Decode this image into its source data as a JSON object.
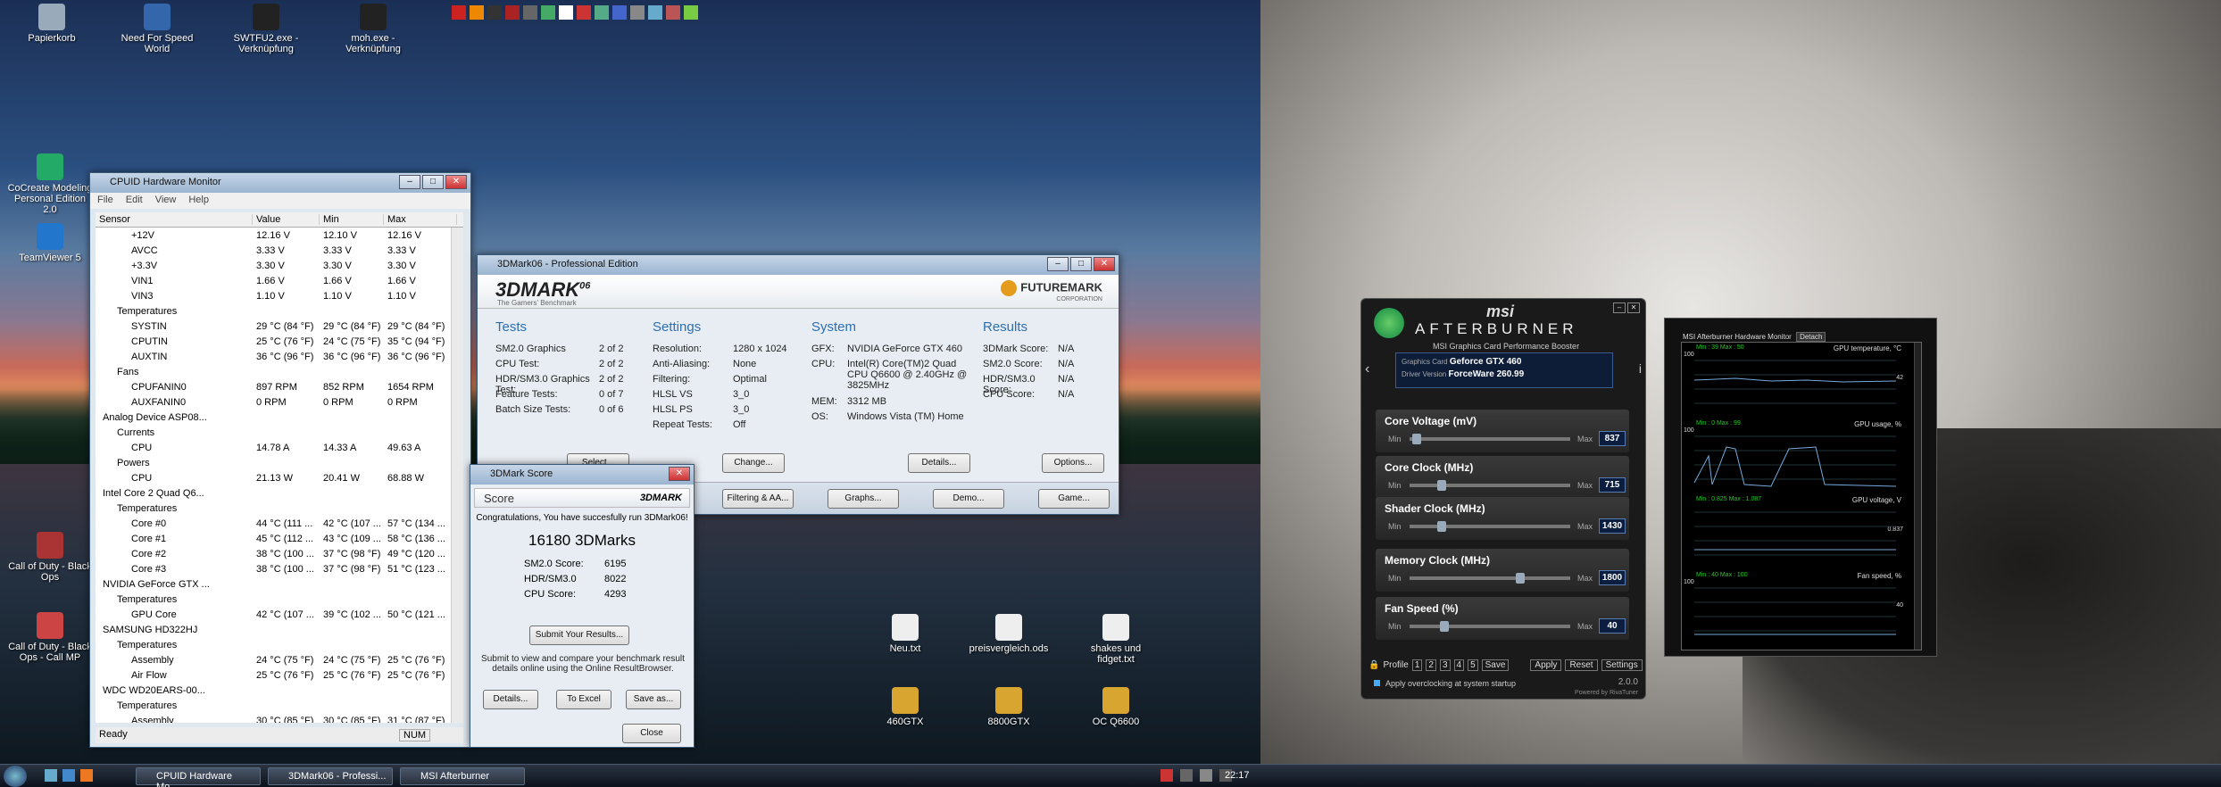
{
  "desktop_left": {
    "icons": [
      {
        "label": "Papierkorb"
      },
      {
        "label": "Need For Speed World"
      },
      {
        "label": "SWTFU2.exe - Verknüpfung"
      },
      {
        "label": "moh.exe - Verknüpfung"
      },
      {
        "label": "CoCreate Modeling Personal Edition 2.0"
      },
      {
        "label": "TeamViewer 5"
      },
      {
        "label": "Call of Duty - Black Ops"
      },
      {
        "label": "Call of Duty - Black Ops - Call MP"
      },
      {
        "label": "Neu.txt"
      },
      {
        "label": "preisvergleich.ods"
      },
      {
        "label": "shakes und fidget.txt"
      },
      {
        "label": "460GTX"
      },
      {
        "label": "8800GTX"
      },
      {
        "label": "OC Q6600"
      }
    ]
  },
  "cpuid": {
    "title": "CPUID Hardware Monitor",
    "menu": [
      "File",
      "Edit",
      "View",
      "Help"
    ],
    "columns": [
      "Sensor",
      "Value",
      "Min",
      "Max"
    ],
    "rows": [
      {
        "sensor": "+12V",
        "value": "12.16 V",
        "min": "12.10 V",
        "max": "12.16 V",
        "indent": 5
      },
      {
        "sensor": "AVCC",
        "value": "3.33 V",
        "min": "3.33 V",
        "max": "3.33 V",
        "indent": 5
      },
      {
        "sensor": "+3.3V",
        "value": "3.30 V",
        "min": "3.30 V",
        "max": "3.30 V",
        "indent": 5
      },
      {
        "sensor": "VIN1",
        "value": "1.66 V",
        "min": "1.66 V",
        "max": "1.66 V",
        "indent": 5
      },
      {
        "sensor": "VIN3",
        "value": "1.10 V",
        "min": "1.10 V",
        "max": "1.10 V",
        "indent": 5
      },
      {
        "sensor": "Temperatures",
        "value": "",
        "min": "",
        "max": "",
        "indent": 3
      },
      {
        "sensor": "SYSTIN",
        "value": "29 °C (84 °F)",
        "min": "29 °C (84 °F)",
        "max": "29 °C (84 °F)",
        "indent": 5
      },
      {
        "sensor": "CPUTIN",
        "value": "25 °C (76 °F)",
        "min": "24 °C (75 °F)",
        "max": "35 °C (94 °F)",
        "indent": 5
      },
      {
        "sensor": "AUXTIN",
        "value": "36 °C (96 °F)",
        "min": "36 °C (96 °F)",
        "max": "36 °C (96 °F)",
        "indent": 5
      },
      {
        "sensor": "Fans",
        "value": "",
        "min": "",
        "max": "",
        "indent": 3
      },
      {
        "sensor": "CPUFANIN0",
        "value": "897 RPM",
        "min": "852 RPM",
        "max": "1654 RPM",
        "indent": 5
      },
      {
        "sensor": "AUXFANIN0",
        "value": "0 RPM",
        "min": "0 RPM",
        "max": "0 RPM",
        "indent": 5
      },
      {
        "sensor": "Analog Device ASP08...",
        "value": "",
        "min": "",
        "max": "",
        "indent": 1
      },
      {
        "sensor": "Currents",
        "value": "",
        "min": "",
        "max": "",
        "indent": 3
      },
      {
        "sensor": "CPU",
        "value": "14.78 A",
        "min": "14.33 A",
        "max": "49.63 A",
        "indent": 5
      },
      {
        "sensor": "Powers",
        "value": "",
        "min": "",
        "max": "",
        "indent": 3
      },
      {
        "sensor": "CPU",
        "value": "21.13 W",
        "min": "20.41 W",
        "max": "68.88 W",
        "indent": 5
      },
      {
        "sensor": "Intel Core 2 Quad Q6...",
        "value": "",
        "min": "",
        "max": "",
        "indent": 1
      },
      {
        "sensor": "Temperatures",
        "value": "",
        "min": "",
        "max": "",
        "indent": 3
      },
      {
        "sensor": "Core #0",
        "value": "44 °C (111 ...",
        "min": "42 °C (107 ...",
        "max": "57 °C (134 ...",
        "indent": 5
      },
      {
        "sensor": "Core #1",
        "value": "45 °C (112 ...",
        "min": "43 °C (109 ...",
        "max": "58 °C (136 ...",
        "indent": 5
      },
      {
        "sensor": "Core #2",
        "value": "38 °C (100 ...",
        "min": "37 °C (98 °F)",
        "max": "49 °C (120 ...",
        "indent": 5
      },
      {
        "sensor": "Core #3",
        "value": "38 °C (100 ...",
        "min": "37 °C (98 °F)",
        "max": "51 °C (123 ...",
        "indent": 5
      },
      {
        "sensor": "NVIDIA GeForce GTX ...",
        "value": "",
        "min": "",
        "max": "",
        "indent": 1
      },
      {
        "sensor": "Temperatures",
        "value": "",
        "min": "",
        "max": "",
        "indent": 3
      },
      {
        "sensor": "GPU Core",
        "value": "42 °C (107 ...",
        "min": "39 °C (102 ...",
        "max": "50 °C (121 ...",
        "indent": 5
      },
      {
        "sensor": "SAMSUNG HD322HJ",
        "value": "",
        "min": "",
        "max": "",
        "indent": 1
      },
      {
        "sensor": "Temperatures",
        "value": "",
        "min": "",
        "max": "",
        "indent": 3
      },
      {
        "sensor": "Assembly",
        "value": "24 °C (75 °F)",
        "min": "24 °C (75 °F)",
        "max": "25 °C (76 °F)",
        "indent": 5
      },
      {
        "sensor": "Air Flow",
        "value": "25 °C (76 °F)",
        "min": "25 °C (76 °F)",
        "max": "25 °C (76 °F)",
        "indent": 5
      },
      {
        "sensor": "WDC WD20EARS-00...",
        "value": "",
        "min": "",
        "max": "",
        "indent": 1
      },
      {
        "sensor": "Temperatures",
        "value": "",
        "min": "",
        "max": "",
        "indent": 3
      },
      {
        "sensor": "Assembly",
        "value": "30 °C (85 °F)",
        "min": "30 °C (85 °F)",
        "max": "31 °C (87 °F)",
        "indent": 5
      }
    ],
    "status": "Ready",
    "num": "NUM"
  },
  "dmark": {
    "title": "3DMark06 - Professional Edition",
    "logo": "3DMARK",
    "logo_sup": "06",
    "tagline": "The Gamers' Benchmark",
    "brand": "FUTUREMARK",
    "brand_sub": "CORPORATION",
    "tests": {
      "heading": "Tests",
      "items": [
        [
          "SM2.0 Graphics",
          "2 of 2"
        ],
        [
          "CPU Test:",
          "2 of 2"
        ],
        [
          "HDR/SM3.0 Graphics Test:",
          "2 of 2"
        ],
        [
          "Feature Tests:",
          "0 of 7"
        ],
        [
          "Batch Size Tests:",
          "0 of 6"
        ]
      ]
    },
    "settings": {
      "heading": "Settings",
      "items": [
        [
          "Resolution:",
          "1280 x 1024"
        ],
        [
          "Anti-Aliasing:",
          "None"
        ],
        [
          "Filtering:",
          "Optimal"
        ],
        [
          "HLSL VS",
          "3_0"
        ],
        [
          "HLSL PS",
          "3_0"
        ],
        [
          "Repeat Tests:",
          "Off"
        ]
      ],
      "button": "Change..."
    },
    "system": {
      "heading": "System",
      "items": [
        [
          "GFX:",
          "NVIDIA GeForce GTX 460"
        ],
        [
          "CPU:",
          "Intel(R) Core(TM)2 Quad CPU Q6600 @ 2.40GHz @ 3825MHz"
        ],
        [
          "MEM:",
          "3312 MB"
        ],
        [
          "OS:",
          "Windows Vista (TM) Home"
        ]
      ],
      "button": "Details..."
    },
    "results": {
      "heading": "Results",
      "items": [
        [
          "3DMark Score:",
          "N/A"
        ],
        [
          "SM2.0 Score:",
          "N/A"
        ],
        [
          "HDR/SM3.0 Score:",
          "N/A"
        ],
        [
          "CPU Score:",
          "N/A"
        ]
      ],
      "button": "Options..."
    },
    "select_btn": "Select...",
    "bottom_buttons": [
      "Filtering & AA...",
      "Graphs...",
      "Demo...",
      "Game..."
    ]
  },
  "score": {
    "title": "3DMark Score",
    "header": "Score",
    "logo": "3DMARK",
    "congrats": "Congratulations, You have succesfully run 3DMark06!",
    "total": "16180 3DMarks",
    "items": [
      [
        "SM2.0 Score:",
        "6195"
      ],
      [
        "HDR/SM3.0",
        "8022"
      ],
      [
        "CPU Score:",
        "4293"
      ]
    ],
    "submit": "Submit Your Results...",
    "info": "Submit to view and compare your benchmark result details online using the Online ResultBrowser.",
    "buttons": [
      "Details...",
      "To Excel",
      "Save as..."
    ],
    "close": "Close"
  },
  "afterburner": {
    "brand": "msi",
    "title": "AFTERBURNER",
    "subtitle": "MSI Graphics Card Performance Booster",
    "card_label": "Graphics Card",
    "card_value": "Geforce GTX 460",
    "driver_label": "Driver Version",
    "driver_value": "ForceWare 260.99",
    "sliders": [
      {
        "label": "Core Voltage (mV)",
        "value": "837",
        "level": 0.02
      },
      {
        "label": "Core Clock (MHz)",
        "value": "715",
        "level": 0.18
      },
      {
        "label": "Shader Clock (MHz)",
        "value": "1430",
        "level": 0.18
      },
      {
        "label": "Memory Clock (MHz)",
        "value": "1800",
        "level": 0.7
      },
      {
        "label": "Fan Speed (%)",
        "value": "40",
        "level": 0.2
      }
    ],
    "min": "Min",
    "max": "Max",
    "auto": "Auto",
    "profile": "Profile",
    "profiles": [
      "1",
      "2",
      "3",
      "4",
      "5"
    ],
    "save": "Save",
    "apply": "Apply",
    "reset": "Reset",
    "settings": "Settings",
    "startup": "Apply overclocking at system startup",
    "version": "2.0.0",
    "powered": "Powered by RivaTuner"
  },
  "monitor": {
    "title": "MSI Afterburner Hardware Monitor",
    "detach": "Detach",
    "graphs": [
      {
        "name": "GPU temperature, °C",
        "min_max": "Min : 39   Max : 50",
        "top": "100",
        "current": "42"
      },
      {
        "name": "GPU usage, %",
        "min_max": "Min : 0   Max : 99",
        "top": "100",
        "current": ""
      },
      {
        "name": "GPU voltage, V",
        "min_max": "Min : 0.825   Max : 1.087",
        "top": "",
        "current": "0.837"
      },
      {
        "name": "Fan speed, %",
        "min_max": "Min : 40   Max : 100",
        "top": "100",
        "current": "40"
      }
    ]
  },
  "taskbar": {
    "items": [
      "CPUID Hardware Mo...",
      "3DMark06 - Professi...",
      "MSI Afterburner"
    ],
    "clock": "22:17"
  }
}
